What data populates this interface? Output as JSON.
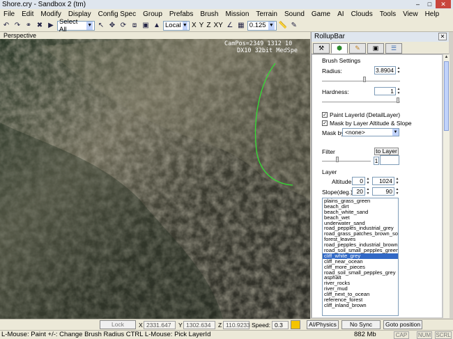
{
  "window": {
    "title": "Shore.cry - Sandbox 2 (tm)"
  },
  "menu": [
    "File",
    "Edit",
    "Modify",
    "Display",
    "Config Spec",
    "Group",
    "Prefabs",
    "Brush",
    "Mission",
    "Terrain",
    "Sound",
    "Game",
    "AI",
    "Clouds",
    "Tools",
    "View",
    "Help"
  ],
  "toolbar": {
    "select_mode": "Select All",
    "coord_system": "Local",
    "axes": [
      "X",
      "Y",
      "Z",
      "XY"
    ],
    "snap_value": "0.125"
  },
  "viewport": {
    "label": "Perspective",
    "camera_line1": "CamPos=2349 1312 10",
    "camera_line2": "DX10 32bit MedSpe"
  },
  "rollup": {
    "title": "RollupBar",
    "section": "Brush Settings",
    "radius_label": "Radius:",
    "radius_value": "3.8904",
    "radius_fraction": 0.55,
    "hardness_label": "Hardness:",
    "hardness_value": "1",
    "hardness_fraction": 1.0,
    "paint_layer_label": "Paint LayerId (DetailLayer)",
    "paint_layer_checked": true,
    "mask_alt_label": "Mask by Layer Altitude & Slope",
    "mask_alt_checked": true,
    "mask_by_label": "Mask by",
    "mask_by_value": "<none>",
    "filter_label": "Filter",
    "to_layer_button": "to Layer",
    "filter_value": "1",
    "filter_fraction": 0.3,
    "layer_label": "Layer",
    "altitude_label": "Altitude",
    "altitude_min": "0",
    "altitude_max": "1024",
    "slope_label": "Slope(deg.)",
    "slope_min": "20",
    "slope_max": "90",
    "layers": [
      "plains_grass_green",
      "beach_dirt",
      "beach_white_sand",
      "beach_wet",
      "underwater_sand",
      "road_pepples_industrial_grey",
      "road_grass_patches_brown_soil",
      "forest_leaves",
      "road_pepples_industrial_brown",
      "road_soil_small_pepples_green",
      "cliff_white_grey",
      "cliff_near_ocean",
      "cliff_more_pieces",
      "road_soil_small_pepples_grey",
      "asphalt",
      "river_rocks",
      "river_mud",
      "cliff_next_to_ocean",
      "reference_forest",
      "cliff_inland_brown"
    ],
    "selected_layer": "cliff_white_grey"
  },
  "status": {
    "lock_selection": "Lock Selection",
    "x_label": "X",
    "x_value": "2331.647",
    "y_label": "Y",
    "y_value": "1302.634",
    "z_label": "Z",
    "z_value": "110.9233",
    "speed_label": "Speed:",
    "speed_value": "0.3",
    "ai_physics": "AI/Physics",
    "sync_player": "No Sync Player",
    "goto_position": "Goto position",
    "hint": "L-Mouse: Paint   +/-: Change Brush Radius   CTRL L-Mouse: Pick LayerId",
    "memory": "882 Mb",
    "caps": "CAP",
    "num": "NUM",
    "scrl": "SCRL"
  }
}
